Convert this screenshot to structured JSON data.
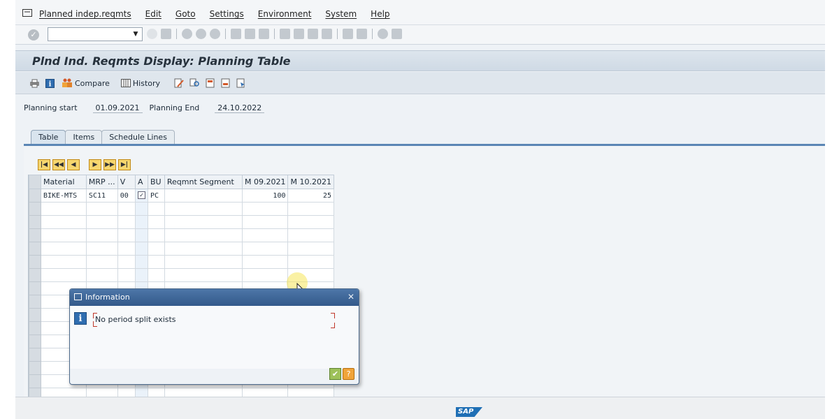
{
  "menubar": {
    "items": [
      "Planned indep.reqmts",
      "Edit",
      "Goto",
      "Settings",
      "Environment",
      "System",
      "Help"
    ]
  },
  "command": {
    "value": ""
  },
  "title": "Plnd Ind. Reqmts Display: Planning Table",
  "app_toolbar": {
    "compare_label": "Compare",
    "history_label": "History"
  },
  "header": {
    "planning_start_label": "Planning start",
    "planning_start_value": "01.09.2021",
    "planning_end_label": "Planning End",
    "planning_end_value": "24.10.2022"
  },
  "tabs": [
    "Table",
    "Items",
    "Schedule Lines"
  ],
  "grid": {
    "columns": [
      "Material",
      "MRP ...",
      "V",
      "A",
      "BU",
      "Reqmnt Segment",
      "M 09.2021",
      "M 10.2021"
    ],
    "rows": [
      [
        "BIKE-MTS",
        "SC11",
        "00",
        "✓",
        "PC",
        "",
        "100",
        "25"
      ]
    ]
  },
  "dialog": {
    "title": "Information",
    "message": "No period split exists"
  },
  "footer": {
    "logo": "SAP"
  },
  "colors": {
    "title_bar": "#cfdae5",
    "dialog_title": "#33598a",
    "nav_button": "#f6d66e",
    "tab_accent": "#5b86b5"
  }
}
